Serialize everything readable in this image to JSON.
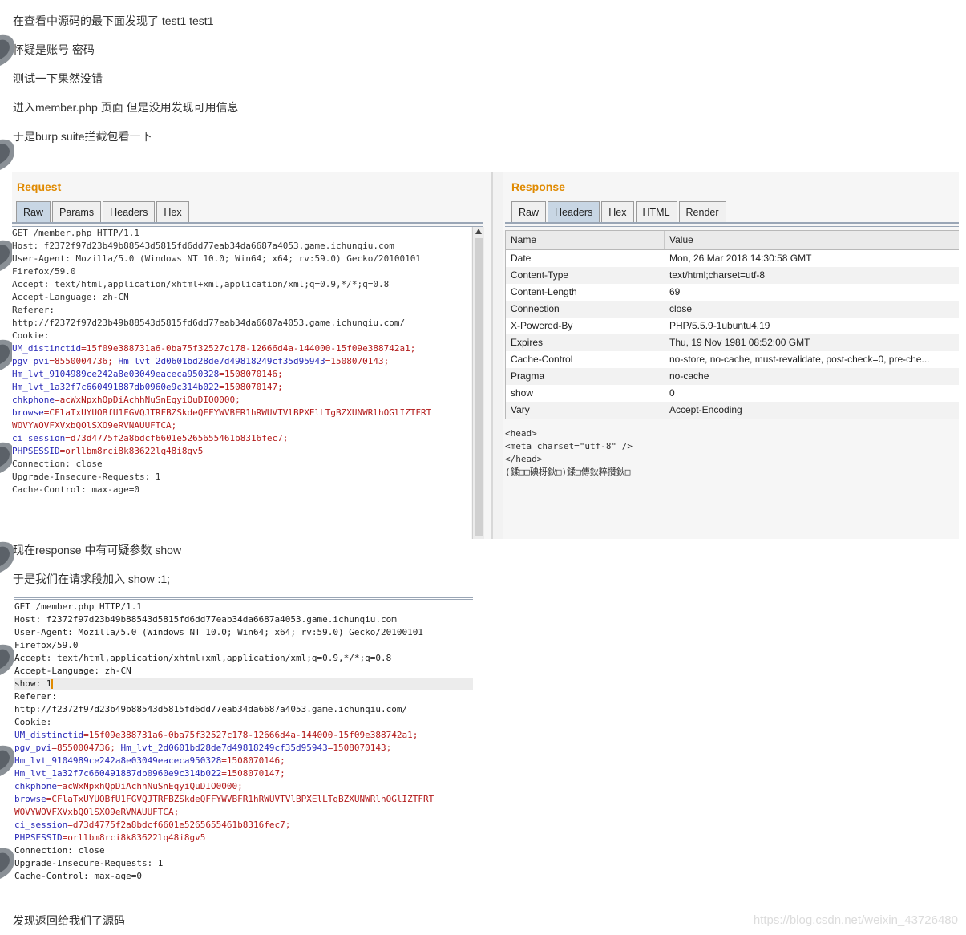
{
  "paragraphs": {
    "p1": "在查看中源码的最下面发现了 test1 test1",
    "p2": "怀疑是账号 密码",
    "p3": "测试一下果然没错",
    "p4": "进入member.php 页面 但是没用发现可用信息",
    "p5": "于是burp suite拦截包看一下",
    "p6": "现在response 中有可疑参数 show",
    "p7": "于是我们在请求段加入 show :1;",
    "p8": "发现返回给我们了源码"
  },
  "request_panel": {
    "title": "Request",
    "tabs": [
      "Raw",
      "Params",
      "Headers",
      "Hex"
    ],
    "active_tab": "Raw",
    "lines": [
      "GET /member.php HTTP/1.1",
      "Host: f2372f97d23b49b88543d5815fd6dd77eab34da6687a4053.game.ichunqiu.com",
      "User-Agent: Mozilla/5.0 (Windows NT 10.0; Win64; x64; rv:59.0) Gecko/20100101",
      "Firefox/59.0",
      "Accept: text/html,application/xhtml+xml,application/xml;q=0.9,*/*;q=0.8",
      "Accept-Language: zh-CN",
      "Referer:",
      "http://f2372f97d23b49b88543d5815fd6dd77eab34da6687a4053.game.ichunqiu.com/",
      "Cookie:"
    ],
    "cookie_lines": [
      {
        "name": "UM_distinctid",
        "value": "=15f09e388731a6-0ba75f32527c178-12666d4a-144000-15f09e388742a1;"
      },
      {
        "name": "pgv_pvi",
        "value": "=8550004736;",
        "name2": "Hm_lvt_2d0601bd28de7d49818249cf35d95943",
        "value2": "=1508070143;"
      },
      {
        "name": "Hm_lvt_9104989ce242a8e03049eaceca950328",
        "value": "=1508070146;"
      },
      {
        "name": "Hm_lvt_1a32f7c660491887db0960e9c314b022",
        "value": "=1508070147;"
      },
      {
        "name": "chkphone",
        "value": "=acWxNpxhQpDiAchhNuSnEqyiQuDIO0000;"
      },
      {
        "name": "browse",
        "value": "=CFlaTxUYUOBfU1FGVQJTRFBZSkdeQFFYWVBFR1hRWUVTVlBPXElLTgBZXUNWRlhOGlIZTFRT"
      },
      {
        "name": "",
        "value": "WOVYWOVFXVxbQOlSXO9eRVNAUUFTCA;"
      },
      {
        "name": "ci_session",
        "value": "=d73d4775f2a8bdcf6601e5265655461b8316fec7;"
      },
      {
        "name": "PHPSESSID",
        "value": "=orllbm8rci8k83622lq48i8gv5"
      }
    ],
    "tail_lines": [
      "Connection: close",
      "Upgrade-Insecure-Requests: 1",
      "Cache-Control: max-age=0"
    ]
  },
  "response_panel": {
    "title": "Response",
    "tabs": [
      "Raw",
      "Headers",
      "Hex",
      "HTML",
      "Render"
    ],
    "active_tab": "Headers",
    "table_header": {
      "name": "Name",
      "value": "Value"
    },
    "headers": [
      {
        "name": "Date",
        "value": "Mon, 26 Mar 2018 14:30:58 GMT"
      },
      {
        "name": "Content-Type",
        "value": "text/html;charset=utf-8"
      },
      {
        "name": "Content-Length",
        "value": "69"
      },
      {
        "name": "Connection",
        "value": "close"
      },
      {
        "name": "X-Powered-By",
        "value": "PHP/5.5.9-1ubuntu4.19"
      },
      {
        "name": "Expires",
        "value": "Thu, 19 Nov 1981 08:52:00 GMT"
      },
      {
        "name": "Cache-Control",
        "value": "no-store, no-cache, must-revalidate, post-check=0, pre-che..."
      },
      {
        "name": "Pragma",
        "value": "no-cache"
      },
      {
        "name": "show",
        "value": "0"
      },
      {
        "name": "Vary",
        "value": "Accept-Encoding"
      }
    ],
    "body_lines": [
      "<head>",
      "<meta charset=\"utf-8\" />",
      "</head>",
      "(鍒□□碘枒鈥□)鍒□傅鈥粹攢鈥□"
    ]
  },
  "request2": {
    "lines_before": [
      "GET /member.php HTTP/1.1",
      "Host: f2372f97d23b49b88543d5815fd6dd77eab34da6687a4053.game.ichunqiu.com",
      "User-Agent: Mozilla/5.0 (Windows NT 10.0; Win64; x64; rv:59.0) Gecko/20100101",
      "Firefox/59.0",
      "Accept: text/html,application/xhtml+xml,application/xml;q=0.9,*/*;q=0.8",
      "Accept-Language: zh-CN"
    ],
    "show_line": "show: 1",
    "lines_after": [
      "Referer:",
      "http://f2372f97d23b49b88543d5815fd6dd77eab34da6687a4053.game.ichunqiu.com/",
      "Cookie:"
    ]
  },
  "watermark": "https://blog.csdn.net/weixin_43726480"
}
